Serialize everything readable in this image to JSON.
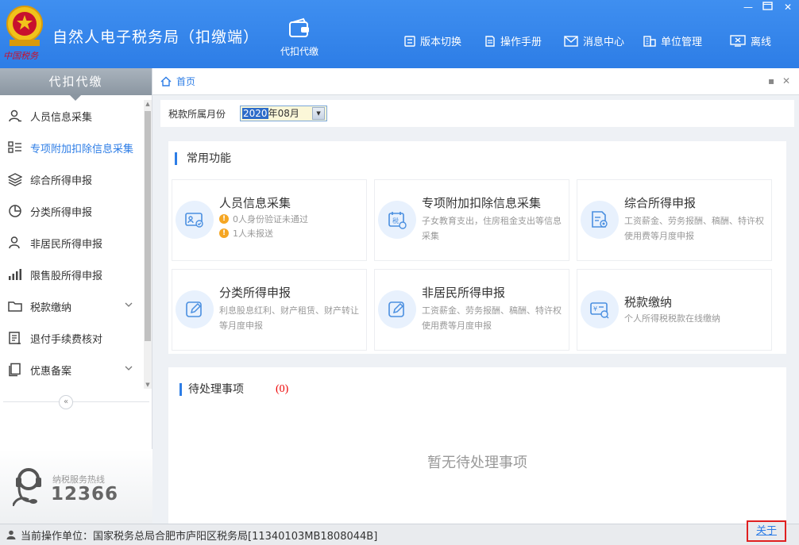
{
  "header": {
    "app_title": "自然人电子税务局（扣缴端）",
    "logo_icon": "tax-emblem-icon",
    "logo_signature": "中国税务",
    "module_tab": {
      "label": "代扣代缴",
      "icon": "wallet-icon"
    },
    "nav": [
      {
        "label": "版本切换",
        "icon": "version-switch-icon"
      },
      {
        "label": "操作手册",
        "icon": "manual-icon"
      },
      {
        "label": "消息中心",
        "icon": "mail-icon"
      },
      {
        "label": "单位管理",
        "icon": "building-icon"
      },
      {
        "label": "离线",
        "icon": "offline-icon"
      }
    ],
    "window_controls": [
      "minimize",
      "maximize",
      "close"
    ],
    "colors": {
      "header_bg": "#2d7de6",
      "accent": "#2d7de6"
    }
  },
  "sidebar": {
    "title": "代扣代缴",
    "items": [
      {
        "label": "人员信息采集",
        "icon": "person-icon",
        "active": false
      },
      {
        "label": "专项附加扣除信息采集",
        "icon": "list-icon",
        "active": true
      },
      {
        "label": "综合所得申报",
        "icon": "layers-icon",
        "active": false
      },
      {
        "label": "分类所得申报",
        "icon": "pie-chart-icon",
        "active": false
      },
      {
        "label": "非居民所得申报",
        "icon": "person-outline-icon",
        "active": false
      },
      {
        "label": "限售股所得申报",
        "icon": "bar-chart-icon",
        "active": false
      },
      {
        "label": "税款缴纳",
        "icon": "folder-icon",
        "active": false,
        "expandable": true
      },
      {
        "label": "退付手续费核对",
        "icon": "document-icon",
        "active": false
      },
      {
        "label": "优惠备案",
        "icon": "copy-icon",
        "active": false,
        "expandable": true
      }
    ],
    "collapse_symbol": "«",
    "hotline": {
      "label": "纳税服务热线",
      "number": "12366"
    }
  },
  "main": {
    "breadcrumb": {
      "label": "首页"
    },
    "filter": {
      "label": "税款所属月份",
      "year": "2020",
      "rest": "年08月"
    },
    "common": {
      "title": "常用功能",
      "cards": [
        {
          "title": "人员信息采集",
          "icon": "id-card-icon",
          "warnings": [
            "0人身份验证未通过",
            "1人未报送"
          ]
        },
        {
          "title": "专项附加扣除信息采集",
          "icon": "tax-calendar-icon",
          "desc": "子女教育支出，住房租金支出等信息采集"
        },
        {
          "title": "综合所得申报",
          "icon": "report-icon",
          "desc": "工资薪金、劳务报酬、稿酬、特许权使用费等月度申报"
        },
        {
          "title": "分类所得申报",
          "icon": "edit-icon",
          "desc": "利息股息红利、财产租赁、财产转让等月度申报"
        },
        {
          "title": "非居民所得申报",
          "icon": "edit-icon",
          "desc": "工资薪金、劳务报酬、稿酬、特许权使用费等月度申报"
        },
        {
          "title": "税款缴纳",
          "icon": "payment-icon",
          "desc": "个人所得税税款在线缴纳"
        }
      ]
    },
    "todo": {
      "title": "待处理事项",
      "count": "(0)",
      "empty": "暂无待处理事项"
    }
  },
  "statusbar": {
    "unit_label": "当前操作单位：国家税务总局合肥市庐阳区税务局[11340103MB1808044B]",
    "about": "关于"
  }
}
